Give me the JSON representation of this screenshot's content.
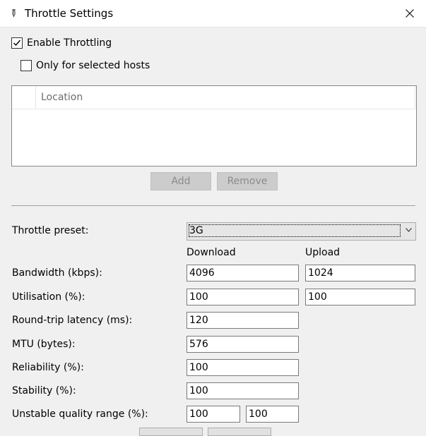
{
  "window": {
    "title": "Throttle Settings",
    "app_icon": "app-icon",
    "close_icon": "close-icon"
  },
  "checkboxes": {
    "enable": {
      "label": "Enable Throttling",
      "checked": true
    },
    "selected_hosts": {
      "label": "Only for selected hosts",
      "checked": false
    }
  },
  "hosts_list": {
    "column_header": "Location",
    "rows": []
  },
  "buttons": {
    "add": "Add",
    "remove": "Remove"
  },
  "preset": {
    "label": "Throttle preset:",
    "value": "3G"
  },
  "columns": {
    "download": "Download",
    "upload": "Upload"
  },
  "fields": {
    "bandwidth": {
      "label": "Bandwidth (kbps):",
      "download": "4096",
      "upload": "1024"
    },
    "utilisation": {
      "label": "Utilisation (%):",
      "download": "100",
      "upload": "100"
    },
    "latency": {
      "label": "Round-trip latency (ms):",
      "value": "120"
    },
    "mtu": {
      "label": "MTU (bytes):",
      "value": "576"
    },
    "reliability": {
      "label": "Reliability (%):",
      "value": "100"
    },
    "stability": {
      "label": "Stability (%):",
      "value": "100"
    },
    "unstable_range": {
      "label": "Unstable quality range (%):",
      "from": "100",
      "to": "100"
    }
  }
}
